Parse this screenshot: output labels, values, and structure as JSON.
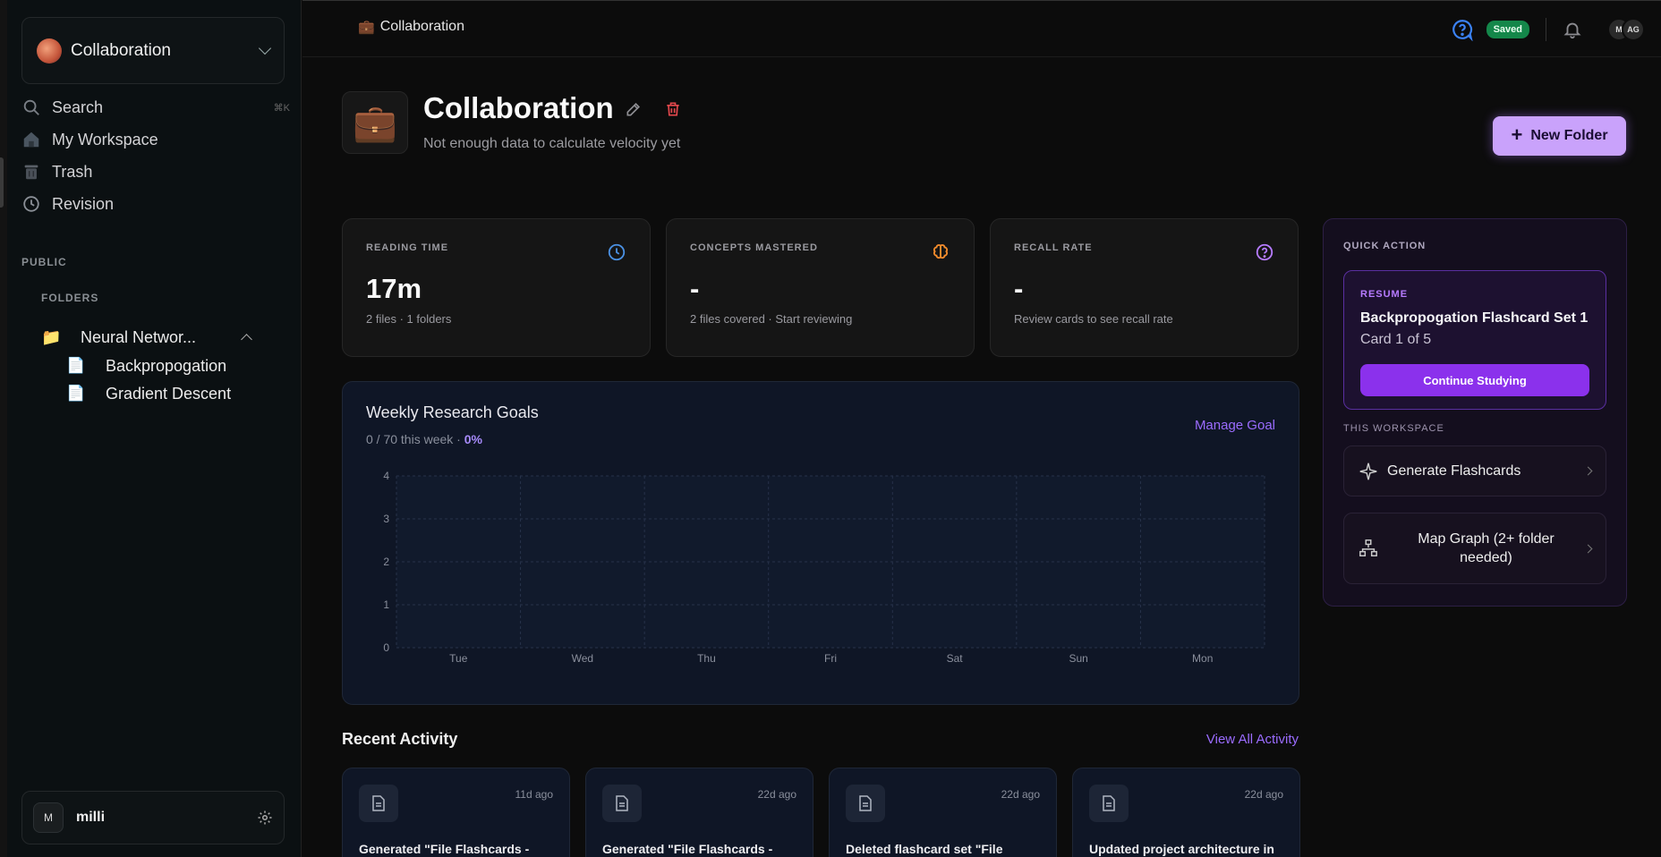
{
  "sidebar": {
    "workspace_name": "Collaboration",
    "nav": [
      {
        "label": "Search",
        "shortcut": "⌘K"
      },
      {
        "label": "My Workspace"
      },
      {
        "label": "Trash"
      },
      {
        "label": "Revision"
      }
    ],
    "public_label": "PUBLIC",
    "folders_label": "FOLDERS",
    "folder": {
      "label": "Neural Networ...",
      "icon": "folder-icon"
    },
    "files": [
      {
        "label": "Backpropogation",
        "icon": "document-icon"
      },
      {
        "label": "Gradient Descent",
        "icon": "document-icon"
      }
    ],
    "user": {
      "initial": "M",
      "name": "milli"
    }
  },
  "topbar": {
    "breadcrumb": "Collaboration",
    "saved_badge": "Saved",
    "avatars": [
      "M",
      "AG"
    ]
  },
  "header": {
    "title": "Collaboration",
    "subtitle": "Not enough data to calculate velocity yet",
    "new_folder_label": "New Folder"
  },
  "stats": [
    {
      "label": "READING TIME",
      "value": "17m",
      "sub": "2 files · 1 folders",
      "icon": "clock-icon",
      "color": "#4a90e2"
    },
    {
      "label": "CONCEPTS MASTERED",
      "value": "-",
      "sub": "2 files covered · Start reviewing",
      "icon": "brain-icon",
      "color": "#f28b2c"
    },
    {
      "label": "RECALL RATE",
      "value": "-",
      "sub": "Review cards to see recall rate",
      "icon": "question-circle-icon",
      "color": "#b57bff"
    }
  ],
  "weekly_goals": {
    "title": "Weekly Research Goals",
    "progress_text": "0 / 70 this week · ",
    "percent": "0%",
    "manage_label": "Manage Goal"
  },
  "chart_data": {
    "type": "line",
    "categories": [
      "Tue",
      "Wed",
      "Thu",
      "Fri",
      "Sat",
      "Sun",
      "Mon"
    ],
    "y_ticks": [
      "0",
      "1",
      "2",
      "3",
      "4"
    ],
    "ylim": [
      0,
      4
    ],
    "grid": true,
    "series": [
      {
        "values": [
          0,
          0,
          0,
          0,
          0,
          0,
          0
        ]
      }
    ]
  },
  "recent_activity": {
    "title": "Recent Activity",
    "view_all_label": "View All Activity",
    "items": [
      {
        "ago": "11d ago",
        "text": "Generated \"File Flashcards -"
      },
      {
        "ago": "22d ago",
        "text": "Generated \"File Flashcards -"
      },
      {
        "ago": "22d ago",
        "text": "Deleted flashcard set \"File"
      },
      {
        "ago": "22d ago",
        "text": "Updated project architecture in"
      }
    ]
  },
  "quick_action": {
    "label": "QUICK ACTION",
    "resume_label": "RESUME",
    "resume_title": "Backpropogation Flashcard Set 1",
    "resume_card": "Card 1 of 5",
    "continue_label": "Continue Studying",
    "workspace_label": "THIS WORKSPACE",
    "generate_label": "Generate Flashcards",
    "map_graph_label": "Map Graph (2+ folder needed)"
  },
  "colors": {
    "accent": "#8b31ec",
    "link": "#9b6cff",
    "saved": "#14874a",
    "danger": "#e5484d"
  }
}
